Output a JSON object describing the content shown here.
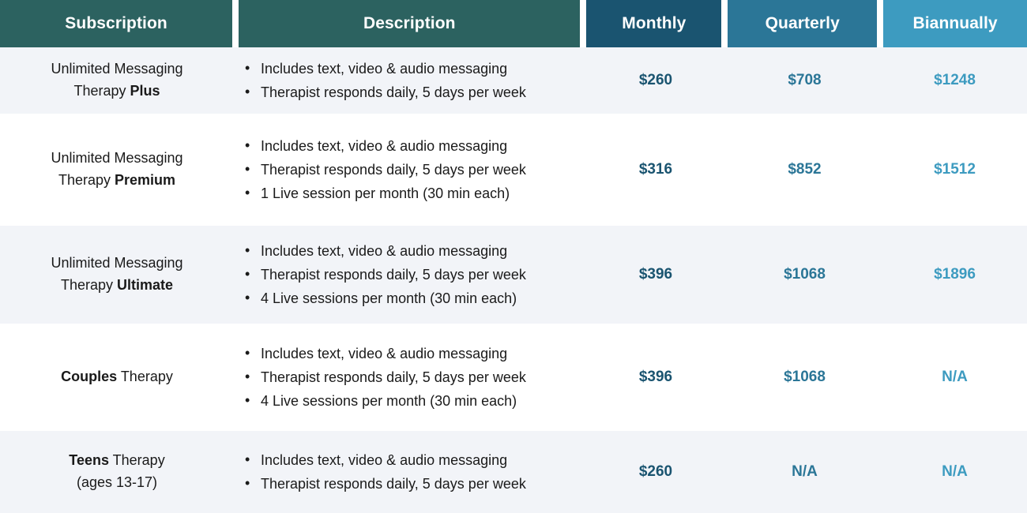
{
  "table": {
    "columns": [
      {
        "key": "subscription",
        "label": "Subscription",
        "header_bg": "#2c6260"
      },
      {
        "key": "description",
        "label": "Description",
        "header_bg": "#2c6260"
      },
      {
        "key": "monthly",
        "label": "Monthly",
        "header_bg": "#1a5470",
        "text_color": "#1a5470"
      },
      {
        "key": "quarterly",
        "label": "Quarterly",
        "header_bg": "#2b7697",
        "text_color": "#2b7697"
      },
      {
        "key": "biannually",
        "label": "Biannually",
        "header_bg": "#3d9bc0",
        "text_color": "#3d9bc0"
      }
    ],
    "rows": [
      {
        "name_prefix": "Unlimited Messaging",
        "name_line2_plain": "Therapy ",
        "name_line2_bold": "Plus",
        "features": [
          "Includes text, video & audio messaging",
          "Therapist responds daily, 5 days per week"
        ],
        "monthly": "$260",
        "quarterly": "$708",
        "biannually": "$1248"
      },
      {
        "name_prefix": "Unlimited Messaging",
        "name_line2_plain": "Therapy ",
        "name_line2_bold": "Premium",
        "features": [
          "Includes text, video & audio messaging",
          "Therapist responds daily, 5 days per week",
          "1 Live session per month (30 min each)"
        ],
        "monthly": "$316",
        "quarterly": "$852",
        "biannually": "$1512"
      },
      {
        "name_prefix": "Unlimited Messaging",
        "name_line2_plain": "Therapy ",
        "name_line2_bold": "Ultimate",
        "features": [
          "Includes text, video & audio messaging",
          "Therapist responds daily, 5 days per week",
          "4 Live sessions per month (30 min each)"
        ],
        "monthly": "$396",
        "quarterly": "$1068",
        "biannually": "$1896"
      },
      {
        "name_prefix": "",
        "name_line2_bold": "Couples",
        "name_line2_plain": " Therapy",
        "bold_first": true,
        "features": [
          "Includes text, video & audio messaging",
          "Therapist responds daily, 5 days per week",
          "4 Live sessions per month (30 min each)"
        ],
        "monthly": "$396",
        "quarterly": "$1068",
        "biannually": "N/A"
      },
      {
        "name_prefix": "",
        "name_line2_bold": "Teens",
        "name_line2_plain": " Therapy",
        "name_line3": "(ages 13-17)",
        "bold_first": true,
        "features": [
          "Includes text, video & audio messaging",
          "Therapist responds daily, 5 days per week"
        ],
        "monthly": "$260",
        "quarterly": "N/A",
        "biannually": "N/A"
      }
    ]
  }
}
